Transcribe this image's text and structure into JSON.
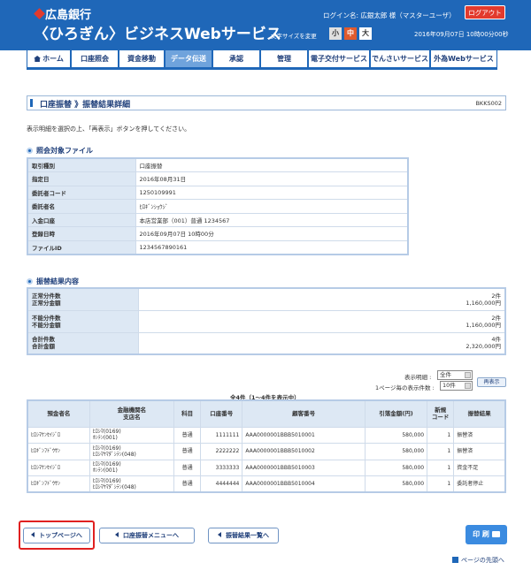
{
  "header": {
    "bank_name": "広島銀行",
    "service_name": "〈ひろぎん〉ビジネスWebサービス",
    "login_label": "ログイン名: 広銀太郎 様（マスターユーザ）",
    "logout_label": "ログアウト",
    "font_size_label": "文字サイズを変更",
    "font_small": "小",
    "font_mid": "中",
    "font_large": "大",
    "datetime": "2016年09月07日 10時00分00秒"
  },
  "nav": {
    "items": [
      {
        "label": "ホーム"
      },
      {
        "label": "口座照会"
      },
      {
        "label": "資金移動"
      },
      {
        "label": "データ伝送"
      },
      {
        "label": "承認"
      },
      {
        "label": "管理"
      },
      {
        "label": "電子交付サービス"
      },
      {
        "label": "でんさいサービス"
      },
      {
        "label": "外為Webサービス"
      }
    ],
    "active": "データ伝送"
  },
  "page": {
    "title": "口座振替 》振替結果詳細",
    "code": "BKKS002",
    "instruction": "表示明細を選択の上、「再表示」ボタンを押してください。"
  },
  "file_section": {
    "title": "照会対象ファイル",
    "rows": [
      {
        "key": "取引種別",
        "value": "口座振替"
      },
      {
        "key": "指定日",
        "value": "2016年08月31日"
      },
      {
        "key": "委託者コード",
        "value": "1250109991"
      },
      {
        "key": "委託者名",
        "value": "ﾋﾛｷﾞﾝｼｮｳｼﾞ"
      },
      {
        "key": "入金口座",
        "value": "本店営業部（001）普通 1234567"
      },
      {
        "key": "登録日時",
        "value": "2016年09月07日 10時00分"
      },
      {
        "key": "ファイルID",
        "value": "1234567890161"
      }
    ]
  },
  "result_section": {
    "title": "振替結果内容",
    "rows": [
      {
        "key1": "正常分件数",
        "key2": "正常分金額",
        "val1": "2件",
        "val2": "1,160,000円"
      },
      {
        "key1": "不能分件数",
        "key2": "不能分金額",
        "val1": "2件",
        "val2": "1,160,000円"
      },
      {
        "key1": "合計件数",
        "key2": "合計金額",
        "val1": "4件",
        "val2": "2,320,000円"
      }
    ]
  },
  "controls": {
    "detail_label": "表示明細 :",
    "detail_value": "全件",
    "per_page_label": "1ページ毎の表示件数 :",
    "per_page_value": "10件",
    "redisplay_label": "再表示",
    "count_label": "全4件（1～4件を表示中）"
  },
  "list": {
    "headers": [
      "預金者名",
      "金融機関名\n支店名",
      "科目",
      "口座番号",
      "顧客番号",
      "引落金額(円)",
      "新規\nコード",
      "振替結果"
    ],
    "rows": [
      {
        "name": "ﾋﾛｼﾏｹﾝｾｲｼﾞﾛ",
        "bank": "ﾋﾛｼﾏ(0169)",
        "branch": "ﾎﾝﾃﾝ(001)",
        "type": "普通",
        "account": "1111111",
        "customer": "AAA0000001BBB5010001",
        "amount": "580,000",
        "new_code": "1",
        "result": "振替済"
      },
      {
        "name": "ﾋﾛｷﾞﾝﾌﾄﾞｳｻﾝ",
        "bank": "ﾋﾛｼﾏ(0169)",
        "branch": "ﾋﾛｼﾏﾔﾏﾀﾞｼﾃﾝ(048)",
        "type": "普通",
        "account": "2222222",
        "customer": "AAA0000001BBB5010002",
        "amount": "580,000",
        "new_code": "1",
        "result": "振替済"
      },
      {
        "name": "ﾋﾛｼﾏｹﾝｾｲｼﾞﾛ",
        "bank": "ﾋﾛｼﾏ(0169)",
        "branch": "ﾎﾝﾃﾝ(001)",
        "type": "普通",
        "account": "3333333",
        "customer": "AAA0000001BBB5010003",
        "amount": "580,000",
        "new_code": "1",
        "result": "資金不足"
      },
      {
        "name": "ﾋﾛｷﾞﾝﾌﾄﾞｳｻﾝ",
        "bank": "ﾋﾛｼﾏ(0169)",
        "branch": "ﾋﾛｼﾏﾔﾏﾀﾞｼﾃﾝ(048)",
        "type": "普通",
        "account": "4444444",
        "customer": "AAA0000001BBB5010004",
        "amount": "580,000",
        "new_code": "1",
        "result": "委託者停止"
      }
    ]
  },
  "buttons": {
    "top_page": "トップページへ",
    "transfer_menu": "口座振替メニューへ",
    "result_list": "振替結果一覧へ",
    "print": "印 刷",
    "page_top": "ページの先頭へ"
  },
  "colors": {
    "brand": "#1f67b8",
    "accent_red": "#e23a2d",
    "highlight_outline": "#e02020"
  }
}
